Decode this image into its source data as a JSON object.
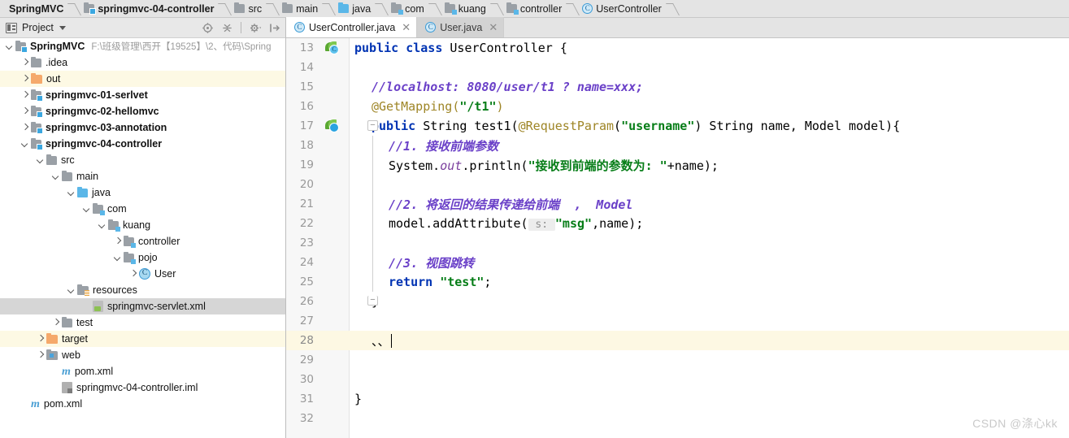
{
  "breadcrumb": {
    "items": [
      {
        "label": "SpringMVC",
        "icon": "none",
        "bold": true
      },
      {
        "label": "springmvc-04-controller",
        "icon": "module-folder-icon",
        "bold": true
      },
      {
        "label": "src",
        "icon": "folder-icon",
        "bold": false
      },
      {
        "label": "main",
        "icon": "folder-icon",
        "bold": false
      },
      {
        "label": "java",
        "icon": "source-folder-icon",
        "bold": false
      },
      {
        "label": "com",
        "icon": "package-folder-icon",
        "bold": false
      },
      {
        "label": "kuang",
        "icon": "package-folder-icon",
        "bold": false
      },
      {
        "label": "controller",
        "icon": "package-folder-icon",
        "bold": false
      },
      {
        "label": "UserController",
        "icon": "java-class-icon",
        "bold": false
      }
    ]
  },
  "project_panel": {
    "title": "Project",
    "tools": [
      "locate-target-icon",
      "collapse-all-icon",
      "settings-gear-icon",
      "hide-panel-icon"
    ],
    "tree": [
      {
        "indent": 0,
        "arrow": "down",
        "icon": "module-folder-icon",
        "label": "SpringMVC",
        "bold": true,
        "path": "F:\\班级管理\\西开【19525】\\2、代码\\Spring",
        "state": "normal"
      },
      {
        "indent": 1,
        "arrow": "right",
        "icon": "folder-icon",
        "label": ".idea",
        "bold": false,
        "path": "",
        "state": "normal"
      },
      {
        "indent": 1,
        "arrow": "right",
        "icon": "excluded-folder-icon",
        "label": "out",
        "bold": false,
        "path": "",
        "state": "excluded"
      },
      {
        "indent": 1,
        "arrow": "right",
        "icon": "module-folder-icon",
        "label": "springmvc-01-serlvet",
        "bold": true,
        "path": "",
        "state": "normal"
      },
      {
        "indent": 1,
        "arrow": "right",
        "icon": "module-folder-icon",
        "label": "springmvc-02-hellomvc",
        "bold": true,
        "path": "",
        "state": "normal"
      },
      {
        "indent": 1,
        "arrow": "right",
        "icon": "module-folder-icon",
        "label": "springmvc-03-annotation",
        "bold": true,
        "path": "",
        "state": "normal"
      },
      {
        "indent": 1,
        "arrow": "down",
        "icon": "module-folder-icon",
        "label": "springmvc-04-controller",
        "bold": true,
        "path": "",
        "state": "normal"
      },
      {
        "indent": 2,
        "arrow": "down",
        "icon": "folder-icon",
        "label": "src",
        "bold": false,
        "path": "",
        "state": "normal"
      },
      {
        "indent": 3,
        "arrow": "down",
        "icon": "folder-icon",
        "label": "main",
        "bold": false,
        "path": "",
        "state": "normal"
      },
      {
        "indent": 4,
        "arrow": "down",
        "icon": "source-folder-icon",
        "label": "java",
        "bold": false,
        "path": "",
        "state": "normal"
      },
      {
        "indent": 5,
        "arrow": "down",
        "icon": "package-folder-icon",
        "label": "com",
        "bold": false,
        "path": "",
        "state": "normal"
      },
      {
        "indent": 6,
        "arrow": "down",
        "icon": "package-folder-icon",
        "label": "kuang",
        "bold": false,
        "path": "",
        "state": "normal"
      },
      {
        "indent": 7,
        "arrow": "right",
        "icon": "package-folder-icon",
        "label": "controller",
        "bold": false,
        "path": "",
        "state": "normal"
      },
      {
        "indent": 7,
        "arrow": "down",
        "icon": "package-folder-icon",
        "label": "pojo",
        "bold": false,
        "path": "",
        "state": "normal"
      },
      {
        "indent": 8,
        "arrow": "right",
        "icon": "java-class-icon",
        "label": "User",
        "bold": false,
        "path": "",
        "state": "normal"
      },
      {
        "indent": 4,
        "arrow": "down",
        "icon": "resources-folder-icon",
        "label": "resources",
        "bold": false,
        "path": "",
        "state": "normal"
      },
      {
        "indent": 5,
        "arrow": "none",
        "icon": "spring-xml-icon",
        "label": "springmvc-servlet.xml",
        "bold": false,
        "path": "",
        "state": "selected"
      },
      {
        "indent": 3,
        "arrow": "right",
        "icon": "folder-icon",
        "label": "test",
        "bold": false,
        "path": "",
        "state": "normal"
      },
      {
        "indent": 2,
        "arrow": "right",
        "icon": "excluded-folder-icon",
        "label": "target",
        "bold": false,
        "path": "",
        "state": "excluded"
      },
      {
        "indent": 2,
        "arrow": "right",
        "icon": "web-folder-icon",
        "label": "web",
        "bold": false,
        "path": "",
        "state": "normal"
      },
      {
        "indent": 3,
        "arrow": "none",
        "icon": "maven-icon",
        "label": "pom.xml",
        "bold": false,
        "path": "",
        "state": "normal"
      },
      {
        "indent": 3,
        "arrow": "none",
        "icon": "iml-icon",
        "label": "springmvc-04-controller.iml",
        "bold": false,
        "path": "",
        "state": "normal"
      },
      {
        "indent": 1,
        "arrow": "none",
        "icon": "maven-icon",
        "label": "pom.xml",
        "bold": false,
        "path": "",
        "state": "normal"
      }
    ]
  },
  "editor": {
    "tabs": [
      {
        "label": "UserController.java",
        "icon": "java-class-icon",
        "active": true,
        "close": "✕"
      },
      {
        "label": "User.java",
        "icon": "java-class-icon",
        "active": false,
        "close": "✕"
      }
    ],
    "lines": [
      {
        "number": "13",
        "gutter": "spring-bean-class-icon",
        "fold": "none",
        "indent": 0,
        "tokens": [
          {
            "t": "kw",
            "v": "public"
          },
          {
            "t": "plain",
            "v": " "
          },
          {
            "t": "kw",
            "v": "class"
          },
          {
            "t": "plain",
            "v": " UserController {"
          }
        ]
      },
      {
        "number": "14",
        "gutter": "none",
        "fold": "none",
        "indent": 0,
        "tokens": []
      },
      {
        "number": "15",
        "gutter": "none",
        "fold": "none",
        "indent": 1,
        "tokens": [
          {
            "t": "cmt",
            "v": "//localhost: 8080/user/t1 ? name=xxx;"
          }
        ]
      },
      {
        "number": "16",
        "gutter": "none",
        "fold": "none",
        "indent": 1,
        "tokens": [
          {
            "t": "ann",
            "v": "@GetMapping("
          },
          {
            "t": "str",
            "v": "\"/t1\""
          },
          {
            "t": "ann",
            "v": ")"
          }
        ]
      },
      {
        "number": "17",
        "gutter": "spring-bean-icon",
        "fold": "start",
        "indent": 1,
        "tokens": [
          {
            "t": "kw",
            "v": "public"
          },
          {
            "t": "plain",
            "v": " String test1("
          },
          {
            "t": "ann",
            "v": "@RequestParam"
          },
          {
            "t": "plain",
            "v": "("
          },
          {
            "t": "str",
            "v": "\"username\""
          },
          {
            "t": "plain",
            "v": ") String name, Model model){"
          }
        ]
      },
      {
        "number": "18",
        "gutter": "none",
        "fold": "bar",
        "indent": 2,
        "tokens": [
          {
            "t": "cmt",
            "v": "//1. 接收前端参数"
          }
        ]
      },
      {
        "number": "19",
        "gutter": "none",
        "fold": "bar",
        "indent": 2,
        "tokens": [
          {
            "t": "plain",
            "v": "System."
          },
          {
            "t": "fld",
            "v": "out"
          },
          {
            "t": "plain",
            "v": ".println("
          },
          {
            "t": "str",
            "v": "\"接收到前端的参数为: \""
          },
          {
            "t": "plain",
            "v": "+name);"
          }
        ]
      },
      {
        "number": "20",
        "gutter": "none",
        "fold": "bar",
        "indent": 0,
        "tokens": []
      },
      {
        "number": "21",
        "gutter": "none",
        "fold": "bar",
        "indent": 2,
        "tokens": [
          {
            "t": "cmt",
            "v": "//2. 将返回的结果传递给前端  ,  Model"
          }
        ]
      },
      {
        "number": "22",
        "gutter": "none",
        "fold": "bar",
        "indent": 2,
        "tokens": [
          {
            "t": "plain",
            "v": "model.addAttribute("
          },
          {
            "t": "hint",
            "v": " s: "
          },
          {
            "t": "str",
            "v": "\"msg\""
          },
          {
            "t": "plain",
            "v": ",name);"
          }
        ]
      },
      {
        "number": "23",
        "gutter": "none",
        "fold": "bar",
        "indent": 0,
        "tokens": []
      },
      {
        "number": "24",
        "gutter": "none",
        "fold": "bar",
        "indent": 2,
        "tokens": [
          {
            "t": "cmt",
            "v": "//3. 视图跳转"
          }
        ]
      },
      {
        "number": "25",
        "gutter": "none",
        "fold": "bar",
        "indent": 2,
        "tokens": [
          {
            "t": "kw",
            "v": "return"
          },
          {
            "t": "plain",
            "v": " "
          },
          {
            "t": "str",
            "v": "\"test\""
          },
          {
            "t": "plain",
            "v": ";"
          }
        ]
      },
      {
        "number": "26",
        "gutter": "none",
        "fold": "end",
        "indent": 1,
        "tokens": [
          {
            "t": "plain",
            "v": "}"
          }
        ]
      },
      {
        "number": "27",
        "gutter": "none",
        "fold": "none",
        "indent": 0,
        "tokens": []
      },
      {
        "number": "28",
        "gutter": "none",
        "fold": "none",
        "indent": 1,
        "caret": true,
        "tokens": [
          {
            "t": "plain",
            "v": "、、"
          }
        ]
      },
      {
        "number": "29",
        "gutter": "none",
        "fold": "none",
        "indent": 0,
        "tokens": []
      },
      {
        "number": "30",
        "gutter": "none",
        "fold": "none",
        "indent": 0,
        "tokens": []
      },
      {
        "number": "31",
        "gutter": "none",
        "fold": "none",
        "indent": 0,
        "tokens": [
          {
            "t": "plain",
            "v": "}"
          }
        ]
      },
      {
        "number": "32",
        "gutter": "none",
        "fold": "none",
        "indent": 0,
        "tokens": []
      }
    ]
  },
  "watermark": "CSDN @涤心kk"
}
